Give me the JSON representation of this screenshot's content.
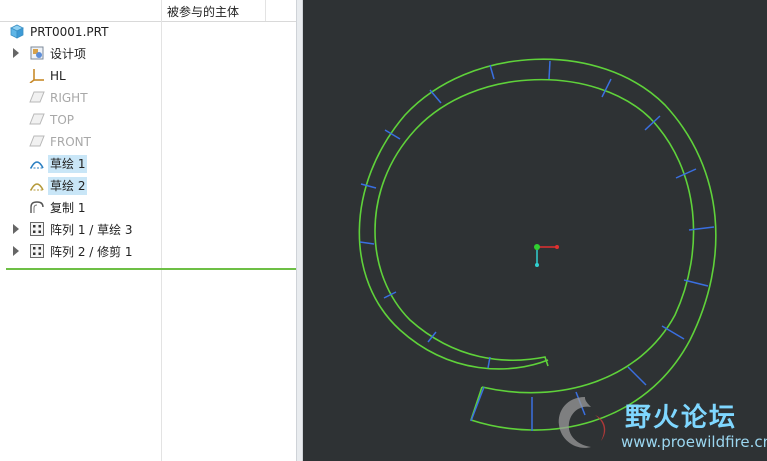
{
  "tree": {
    "column_header": "被参与的主体",
    "items": [
      {
        "label": "PRT0001.PRT",
        "icon": "part-icon",
        "expandable": false,
        "dim": false,
        "selected": false
      },
      {
        "label": "设计项",
        "icon": "design-items-icon",
        "expandable": true,
        "dim": false,
        "selected": false
      },
      {
        "label": "HL",
        "icon": "csys-icon",
        "expandable": false,
        "dim": false,
        "selected": false
      },
      {
        "label": "RIGHT",
        "icon": "datum-plane-icon",
        "expandable": false,
        "dim": true,
        "selected": false
      },
      {
        "label": "TOP",
        "icon": "datum-plane-icon",
        "expandable": false,
        "dim": true,
        "selected": false
      },
      {
        "label": "FRONT",
        "icon": "datum-plane-icon",
        "expandable": false,
        "dim": true,
        "selected": false
      },
      {
        "label": "草绘 1",
        "icon": "sketch-icon",
        "expandable": false,
        "dim": false,
        "selected": true
      },
      {
        "label": "草绘 2",
        "icon": "sketch-icon",
        "expandable": false,
        "dim": false,
        "selected": true
      },
      {
        "label": "复制 1",
        "icon": "copy-icon",
        "expandable": false,
        "dim": false,
        "selected": false
      },
      {
        "label": "阵列 1 / 草绘 3",
        "icon": "pattern-icon",
        "expandable": true,
        "dim": false,
        "selected": false
      },
      {
        "label": "阵列 2 / 修剪 1",
        "icon": "pattern-icon",
        "expandable": true,
        "dim": false,
        "selected": false
      }
    ]
  },
  "watermark": {
    "title": "野火论坛",
    "url": "www.proewildfire.cn"
  },
  "colors": {
    "viewport_bg": "#2e3234",
    "curve_green": "#5fd23a",
    "pattern_blue": "#3a6fe0",
    "selection_bg": "#c9e6f7",
    "feature_end_line": "#6dbf45"
  }
}
